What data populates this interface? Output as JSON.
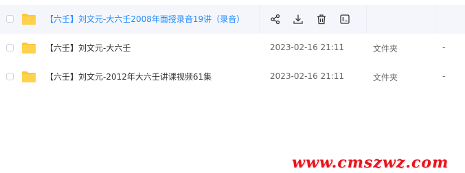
{
  "files": [
    {
      "name": "【六壬】刘文元-大六壬2008年面授录音19讲（录音）",
      "time": "",
      "type": "",
      "size": "",
      "hovered": true
    },
    {
      "name": "【六壬】刘文元-大六壬",
      "time": "2023-02-16 21:11",
      "type": "文件夹",
      "size": "-",
      "hovered": false
    },
    {
      "name": "【六壬】刘文元-2012年大六壬讲课视频61集",
      "time": "2023-02-16 21:11",
      "type": "文件夹",
      "size": "-",
      "hovered": false
    }
  ],
  "row_actions": [
    {
      "icon": "share-icon"
    },
    {
      "icon": "download-icon"
    },
    {
      "icon": "delete-icon"
    },
    {
      "icon": "more-icon"
    }
  ],
  "colors": {
    "folder": "#ffc53d",
    "highlight_text": "#1f8bff",
    "hover_bg": "#f4f6fb",
    "watermark": "#e6141e"
  },
  "watermark": "www.cmszwz.com"
}
